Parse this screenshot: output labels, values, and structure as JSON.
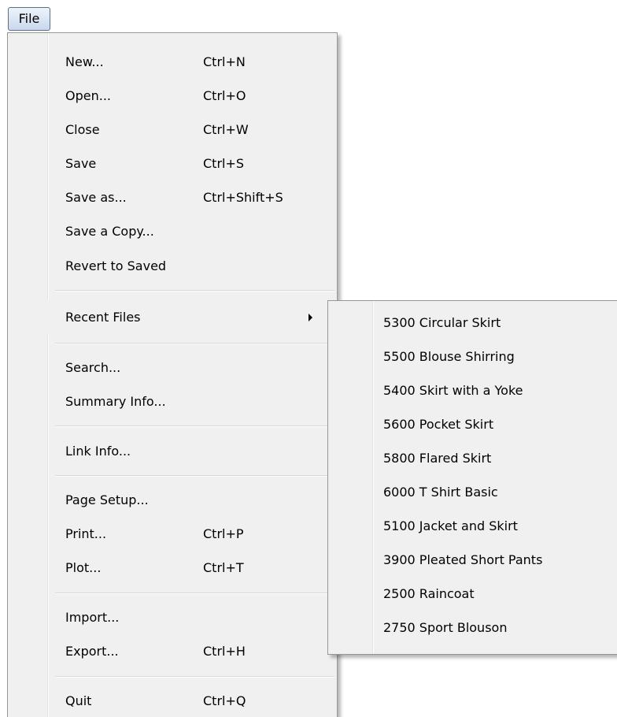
{
  "menubar": {
    "file_label": "File"
  },
  "file_menu": {
    "items": [
      {
        "label": "New...",
        "shortcut": "Ctrl+N"
      },
      {
        "label": "Open...",
        "shortcut": "Ctrl+O"
      },
      {
        "label": "Close",
        "shortcut": "Ctrl+W"
      },
      {
        "label": "Save",
        "shortcut": "Ctrl+S"
      },
      {
        "label": "Save as...",
        "shortcut": "Ctrl+Shift+S"
      },
      {
        "label": "Save a Copy...",
        "shortcut": ""
      },
      {
        "label": "Revert to Saved",
        "shortcut": ""
      },
      {
        "label": "Recent Files",
        "shortcut": "",
        "submenu": true
      },
      {
        "label": "Search...",
        "shortcut": ""
      },
      {
        "label": "Summary Info...",
        "shortcut": ""
      },
      {
        "label": "Link Info...",
        "shortcut": ""
      },
      {
        "label": "Page Setup...",
        "shortcut": ""
      },
      {
        "label": "Print...",
        "shortcut": "Ctrl+P"
      },
      {
        "label": "Plot...",
        "shortcut": "Ctrl+T"
      },
      {
        "label": "Import...",
        "shortcut": ""
      },
      {
        "label": "Export...",
        "shortcut": "Ctrl+H"
      },
      {
        "label": "Quit",
        "shortcut": "Ctrl+Q"
      }
    ]
  },
  "recent_files_menu": {
    "items": [
      "5300 Circular Skirt",
      "5500 Blouse Shirring",
      "5400 Skirt with a Yoke",
      "5600 Pocket Skirt",
      "5800 Flared Skirt",
      "6000 T Shirt Basic",
      "5100 Jacket and Skirt",
      "3900 Pleated Short Pants",
      "2500 Raincoat",
      "2750 Sport Blouson"
    ]
  },
  "icons": {
    "submenu_arrow": "chevron-right-icon"
  }
}
